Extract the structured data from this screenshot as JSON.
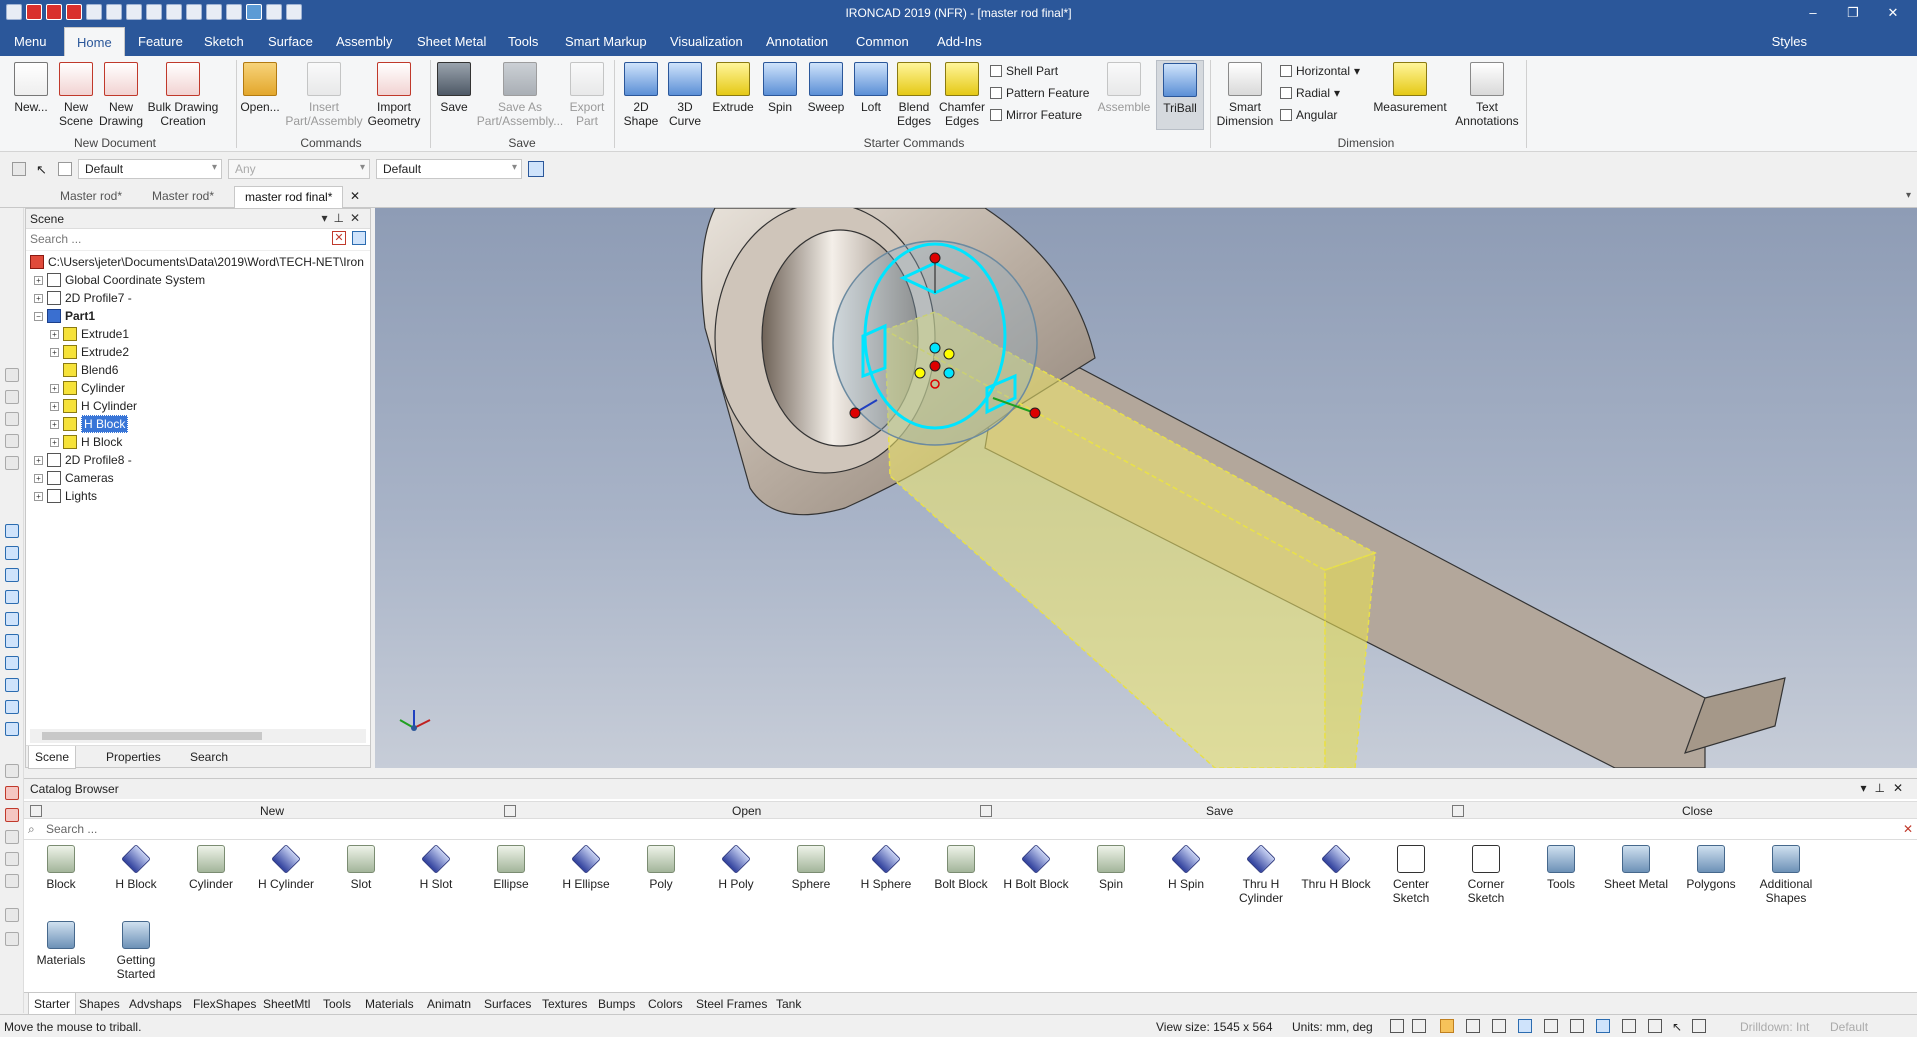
{
  "window": {
    "title": "IRONCAD 2019 (NFR) - [master rod final*]",
    "controls": [
      "–",
      "❐",
      "✕"
    ]
  },
  "menu": {
    "tabs": [
      "Menu",
      "Home",
      "Feature",
      "Sketch",
      "Surface",
      "Assembly",
      "Sheet Metal",
      "Tools",
      "Smart Markup",
      "Visualization",
      "Annotation",
      "Common",
      "Add-Ins"
    ],
    "active": "Home",
    "styles_label": "Styles"
  },
  "ribbon": {
    "groups": {
      "new_document": "New Document",
      "commands": "Commands",
      "save": "Save",
      "starter_commands": "Starter Commands",
      "dimension": "Dimension"
    },
    "buttons": {
      "new": "New...",
      "new_scene_1": "New",
      "new_scene_2": "Scene",
      "new_drawing_1": "New",
      "new_drawing_2": "Drawing",
      "bulk_1": "Bulk Drawing",
      "bulk_2": "Creation",
      "open": "Open...",
      "insert_1": "Insert",
      "insert_2": "Part/Assembly",
      "import_1": "Import",
      "import_2": "Geometry",
      "save": "Save",
      "saveas_1": "Save As",
      "saveas_2": "Part/Assembly...",
      "export_1": "Export",
      "export_2": "Part",
      "shape2d_1": "2D",
      "shape2d_2": "Shape",
      "curve3d_1": "3D",
      "curve3d_2": "Curve",
      "extrude": "Extrude",
      "spin": "Spin",
      "sweep": "Sweep",
      "loft": "Loft",
      "blend_1": "Blend",
      "blend_2": "Edges",
      "chamfer_1": "Chamfer",
      "chamfer_2": "Edges",
      "shell_part": "Shell Part",
      "pattern_feature": "Pattern Feature",
      "mirror_feature": "Mirror Feature",
      "assemble": "Assemble",
      "triball": "TriBall",
      "smart_dim_1": "Smart",
      "smart_dim_2": "Dimension",
      "horizontal": "Horizontal",
      "radial": "Radial",
      "angular": "Angular",
      "measurement": "Measurement",
      "text_ann_1": "Text",
      "text_ann_2": "Annotations"
    }
  },
  "selection_toolbar": {
    "combo1": "Default",
    "combo2": "Any",
    "combo3": "Default"
  },
  "doc_tabs": [
    "Master rod*",
    "Master rod*",
    "master rod final*"
  ],
  "scene_panel": {
    "title": "Scene",
    "search_placeholder": "Search ...",
    "root_path": "C:\\Users\\jeter\\Documents\\Data\\2019\\Word\\TECH-NET\\Iron",
    "nodes": [
      "Global Coordinate System",
      "2D Profile7 -",
      "Part1",
      "Extrude1",
      "Extrude2",
      "Blend6",
      "Cylinder",
      "H Cylinder",
      "H Block",
      "H Block",
      "2D Profile8 -",
      "Cameras",
      "Lights"
    ],
    "tabs": [
      "Scene",
      "Properties",
      "Search"
    ]
  },
  "catalog": {
    "title": "Catalog Browser",
    "actions": [
      "New",
      "Open",
      "Save",
      "Close"
    ],
    "search_placeholder": "Search ...",
    "items": [
      {
        "label1": "Block",
        "label2": ""
      },
      {
        "label1": "H Block",
        "label2": ""
      },
      {
        "label1": "Cylinder",
        "label2": ""
      },
      {
        "label1": "H Cylinder",
        "label2": ""
      },
      {
        "label1": "Slot",
        "label2": ""
      },
      {
        "label1": "H Slot",
        "label2": ""
      },
      {
        "label1": "Ellipse",
        "label2": ""
      },
      {
        "label1": "H Ellipse",
        "label2": ""
      },
      {
        "label1": "Poly",
        "label2": ""
      },
      {
        "label1": "H Poly",
        "label2": ""
      },
      {
        "label1": "Sphere",
        "label2": ""
      },
      {
        "label1": "H Sphere",
        "label2": ""
      },
      {
        "label1": "Bolt Block",
        "label2": ""
      },
      {
        "label1": "H Bolt Block",
        "label2": ""
      },
      {
        "label1": "Spin",
        "label2": ""
      },
      {
        "label1": "H Spin",
        "label2": ""
      },
      {
        "label1": "Thru H",
        "label2": "Cylinder"
      },
      {
        "label1": "Thru H Block",
        "label2": ""
      },
      {
        "label1": "Center",
        "label2": "Sketch"
      },
      {
        "label1": "Corner",
        "label2": "Sketch"
      },
      {
        "label1": "Tools",
        "label2": ""
      },
      {
        "label1": "Sheet Metal",
        "label2": ""
      },
      {
        "label1": "Polygons",
        "label2": ""
      },
      {
        "label1": "Additional",
        "label2": "Shapes"
      },
      {
        "label1": "Materials",
        "label2": ""
      },
      {
        "label1": "Getting",
        "label2": "Started"
      }
    ],
    "tabs": [
      "Starter",
      "Shapes",
      "Advshaps",
      "FlexShapes",
      "SheetMtl",
      "Tools",
      "Materials",
      "Animatn",
      "Surfaces",
      "Textures",
      "Bumps",
      "Colors",
      "Steel Frames",
      "Tank"
    ]
  },
  "status": {
    "message": "Move the mouse to triball.",
    "view_size": "View size: 1545 x 564",
    "units": "Units: mm, deg",
    "drilldown": "Drilldown: Int",
    "default": "Default"
  },
  "colors": {
    "brand": "#2b579a",
    "triball": "#00e5ff",
    "selection": "#f3ea6a"
  }
}
